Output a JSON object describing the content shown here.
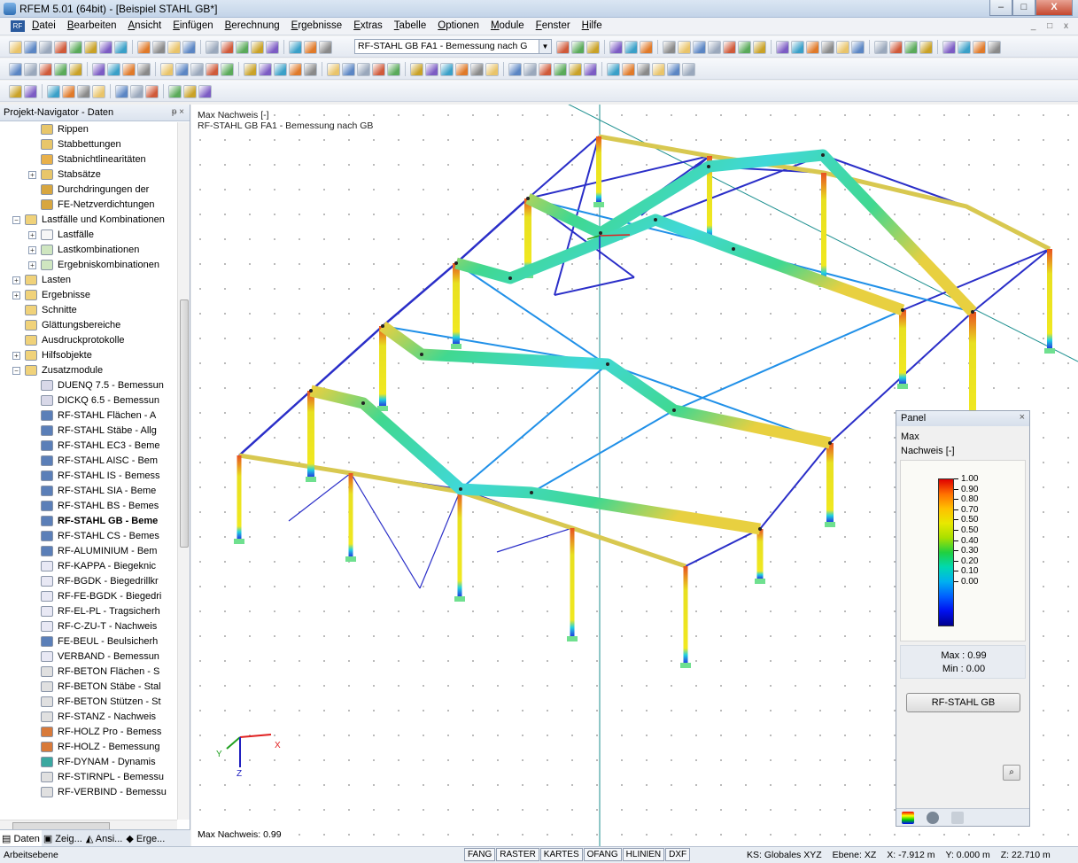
{
  "window": {
    "title": "RFEM 5.01 (64bit) - [Beispiel STAHL GB*]",
    "controls": [
      "–",
      "□",
      "X"
    ]
  },
  "menu": {
    "items": [
      "Datei",
      "Bearbeiten",
      "Ansicht",
      "Einfügen",
      "Berechnung",
      "Ergebnisse",
      "Extras",
      "Tabelle",
      "Optionen",
      "Module",
      "Fenster",
      "Hilfe"
    ],
    "mdi_controls": "_ □ x"
  },
  "toolbar": {
    "result_combo": "RF-STAHL GB FA1 - Bemessung nach G"
  },
  "navigator": {
    "title": "Projekt-Navigator - Daten",
    "pin": "ᵽ ×",
    "items": [
      {
        "label": "Rippen",
        "level": 3,
        "bold": false,
        "exp": "",
        "color": "#e8c66a"
      },
      {
        "label": "Stabbettungen",
        "level": 3,
        "bold": false,
        "exp": "",
        "color": "#e8c66a"
      },
      {
        "label": "Stabnichtlinearitäten",
        "level": 3,
        "bold": false,
        "exp": "",
        "color": "#e8b04a"
      },
      {
        "label": "Stabsätze",
        "level": 3,
        "bold": false,
        "exp": "+",
        "color": "#e8c66a"
      },
      {
        "label": "Durchdringungen der",
        "level": 3,
        "bold": false,
        "exp": "",
        "color": "#d7a640"
      },
      {
        "label": "FE-Netzverdichtungen",
        "level": 3,
        "bold": false,
        "exp": "",
        "color": "#d7a640"
      },
      {
        "label": "Lastfälle und Kombinationen",
        "level": 2,
        "bold": false,
        "exp": "−",
        "color": "#f0d27a"
      },
      {
        "label": "Lastfälle",
        "level": 3,
        "bold": false,
        "exp": "+",
        "color": "#f6f6f6"
      },
      {
        "label": "Lastkombinationen",
        "level": 3,
        "bold": false,
        "exp": "+",
        "color": "#cfe6c0"
      },
      {
        "label": "Ergebniskombinationen",
        "level": 3,
        "bold": false,
        "exp": "+",
        "color": "#cfe6c0"
      },
      {
        "label": "Lasten",
        "level": 2,
        "bold": false,
        "exp": "+",
        "color": "#f0d27a"
      },
      {
        "label": "Ergebnisse",
        "level": 2,
        "bold": false,
        "exp": "+",
        "color": "#f0d27a"
      },
      {
        "label": "Schnitte",
        "level": 2,
        "bold": false,
        "exp": "",
        "color": "#f0d27a"
      },
      {
        "label": "Glättungsbereiche",
        "level": 2,
        "bold": false,
        "exp": "",
        "color": "#f0d27a"
      },
      {
        "label": "Ausdruckprotokolle",
        "level": 2,
        "bold": false,
        "exp": "",
        "color": "#f0d27a"
      },
      {
        "label": "Hilfsobjekte",
        "level": 2,
        "bold": false,
        "exp": "+",
        "color": "#f0d27a"
      },
      {
        "label": "Zusatzmodule",
        "level": 2,
        "bold": false,
        "exp": "−",
        "color": "#f0d27a"
      },
      {
        "label": "DUENQ 7.5 - Bemessun",
        "level": 3,
        "bold": false,
        "exp": "",
        "color": "#d8d8e8"
      },
      {
        "label": "DICKQ 6.5 - Bemessun",
        "level": 3,
        "bold": false,
        "exp": "",
        "color": "#d8d8e8"
      },
      {
        "label": "RF-STAHL Flächen - A",
        "level": 3,
        "bold": false,
        "exp": "",
        "color": "#5b7fb8"
      },
      {
        "label": "RF-STAHL Stäbe - Allg",
        "level": 3,
        "bold": false,
        "exp": "",
        "color": "#5b7fb8"
      },
      {
        "label": "RF-STAHL EC3 - Beme",
        "level": 3,
        "bold": false,
        "exp": "",
        "color": "#5b7fb8"
      },
      {
        "label": "RF-STAHL AISC - Bem",
        "level": 3,
        "bold": false,
        "exp": "",
        "color": "#5b7fb8"
      },
      {
        "label": "RF-STAHL IS - Bemess",
        "level": 3,
        "bold": false,
        "exp": "",
        "color": "#5b7fb8"
      },
      {
        "label": "RF-STAHL SIA - Beme",
        "level": 3,
        "bold": false,
        "exp": "",
        "color": "#5b7fb8"
      },
      {
        "label": "RF-STAHL BS - Bemes",
        "level": 3,
        "bold": false,
        "exp": "",
        "color": "#5b7fb8"
      },
      {
        "label": "RF-STAHL GB - Beme",
        "level": 3,
        "bold": true,
        "exp": "",
        "color": "#5b7fb8"
      },
      {
        "label": "RF-STAHL CS - Bemes",
        "level": 3,
        "bold": false,
        "exp": "",
        "color": "#5b7fb8"
      },
      {
        "label": "RF-ALUMINIUM - Bem",
        "level": 3,
        "bold": false,
        "exp": "",
        "color": "#5b7fb8"
      },
      {
        "label": "RF-KAPPA - Biegeknic",
        "level": 3,
        "bold": false,
        "exp": "",
        "color": "#e8e8f4"
      },
      {
        "label": "RF-BGDK - Biegedrillkr",
        "level": 3,
        "bold": false,
        "exp": "",
        "color": "#e8e8f4"
      },
      {
        "label": "RF-FE-BGDK - Biegedri",
        "level": 3,
        "bold": false,
        "exp": "",
        "color": "#e8e8f4"
      },
      {
        "label": "RF-EL-PL - Tragsicherh",
        "level": 3,
        "bold": false,
        "exp": "",
        "color": "#e8e8f4"
      },
      {
        "label": "RF-C-ZU-T - Nachweis",
        "level": 3,
        "bold": false,
        "exp": "",
        "color": "#e8e8f4"
      },
      {
        "label": "FE-BEUL - Beulsicherh",
        "level": 3,
        "bold": false,
        "exp": "",
        "color": "#5b7fb8"
      },
      {
        "label": "VERBAND - Bemessun",
        "level": 3,
        "bold": false,
        "exp": "",
        "color": "#e8e8f4"
      },
      {
        "label": "RF-BETON Flächen - S",
        "level": 3,
        "bold": false,
        "exp": "",
        "color": "#e0e0e0"
      },
      {
        "label": "RF-BETON Stäbe - Stal",
        "level": 3,
        "bold": false,
        "exp": "",
        "color": "#e0e0e0"
      },
      {
        "label": "RF-BETON Stützen - St",
        "level": 3,
        "bold": false,
        "exp": "",
        "color": "#e0e0e0"
      },
      {
        "label": "RF-STANZ - Nachweis",
        "level": 3,
        "bold": false,
        "exp": "",
        "color": "#e0e0e0"
      },
      {
        "label": "RF-HOLZ Pro - Bemess",
        "level": 3,
        "bold": false,
        "exp": "",
        "color": "#d87a3a"
      },
      {
        "label": "RF-HOLZ - Bemessung",
        "level": 3,
        "bold": false,
        "exp": "",
        "color": "#d87a3a"
      },
      {
        "label": "RF-DYNAM - Dynamis",
        "level": 3,
        "bold": false,
        "exp": "",
        "color": "#3aa8a0"
      },
      {
        "label": "RF-STIRNPL - Bemessu",
        "level": 3,
        "bold": false,
        "exp": "",
        "color": "#e0e0e0"
      },
      {
        "label": "RF-VERBIND - Bemessu",
        "level": 3,
        "bold": false,
        "exp": "",
        "color": "#e0e0e0"
      }
    ],
    "tabs": [
      "Daten",
      "Zeig...",
      "Ansi...",
      "Erge..."
    ]
  },
  "view": {
    "info_line1": "Max Nachweis [-]",
    "info_line2": "RF-STAHL GB FA1 - Bemessung nach GB",
    "max_label": "Max Nachweis: 0.99",
    "axis_labels": {
      "x": "X",
      "y": "Y",
      "z": "Z"
    }
  },
  "panel": {
    "title": "Panel",
    "close": "×",
    "line1": "Max",
    "line2": "Nachweis [-]",
    "legend": [
      "1.00",
      "0.90",
      "0.80",
      "0.70",
      "0.50",
      "0.50",
      "0.40",
      "0.30",
      "0.20",
      "0.10",
      "0.00"
    ],
    "max_text": "Max  :  0.99",
    "min_text": "Min  :  0.00",
    "button": "RF-STAHL GB"
  },
  "status": {
    "left": "Arbeitsebene",
    "toggles": [
      "FANG",
      "RASTER",
      "KARTES",
      "OFANG",
      "HLINIEN",
      "DXF"
    ],
    "ks": "KS: Globales XYZ",
    "ebene": "Ebene: XZ",
    "x": "X:  -7.912 m",
    "y": "Y:  0.000 m",
    "z": "Z:  22.710 m"
  }
}
